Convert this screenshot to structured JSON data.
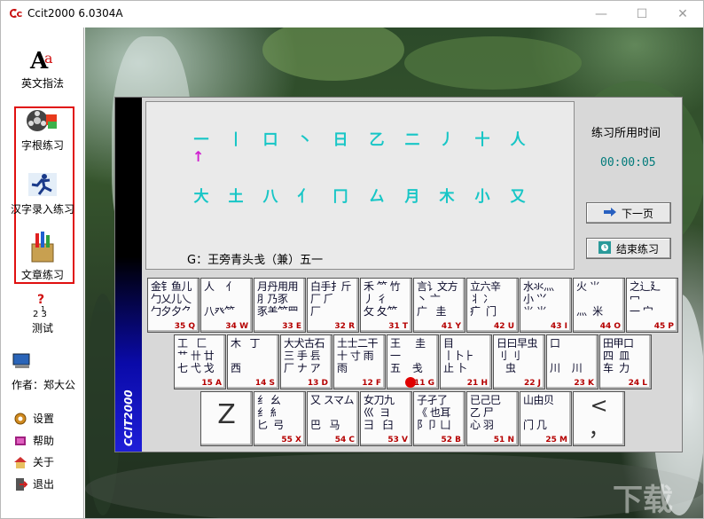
{
  "window": {
    "title": "Ccit2000 6.0304A",
    "minimize": "—",
    "maximize": "☐",
    "close": "✕"
  },
  "sidebar": {
    "english_guide": "英文指法",
    "radical_practice": "字根练习",
    "hanzi_input": "汉字录入练习",
    "article_practice": "文章练习",
    "test": "测试",
    "author": "作者：郑大公",
    "settings": "设置",
    "help": "帮助",
    "about": "关于",
    "exit": "退出"
  },
  "exercise": {
    "row1": [
      "一",
      "丨",
      "口",
      "丶",
      "日",
      "乙",
      "二",
      "丿",
      "十",
      "人"
    ],
    "row2": [
      "大",
      "土",
      "八",
      "亻",
      "冂",
      "厶",
      "月",
      "木",
      "小",
      "又"
    ],
    "hint": "G：王旁青头戋（兼）五一"
  },
  "timer": {
    "label": "练习所用时间",
    "value": "00:00:05"
  },
  "buttons": {
    "next": "下一页",
    "finish": "结束练习"
  },
  "brand": "CCIT2000",
  "keyboard": {
    "row1": [
      {
        "rads": "金钅鱼儿\n勹乂儿乀\n勹夕夕⺈",
        "code": "35 Q"
      },
      {
        "rads": "人    亻\n\n八癶⺮",
        "code": "34 W"
      },
      {
        "rads": "月丹用用\n⺼乃豕\n豕⺷⺮⺲",
        "code": "33 E"
      },
      {
        "rads": "白手扌斤\n厂 ⺁\n厂",
        "code": "32 R"
      },
      {
        "rads": "禾 ⺮ 竹\n丿 彳\n攵 夂⺮",
        "code": "31 T"
      },
      {
        "rads": "言讠文方\n丶 亠\n广   圭",
        "code": "41 Y"
      },
      {
        "rads": "立六辛\n丬 冫\n疒  门",
        "code": "42 U"
      },
      {
        "rads": "水氺⺣\n小 ⺍\n⺌ ⺌",
        "code": "43 I"
      },
      {
        "rads": "火 ⺌\n\n⺣  米",
        "code": "44 O"
      },
      {
        "rads": "之辶廴\n冖\n一 宀",
        "code": "45 P"
      }
    ],
    "row2": [
      {
        "rads": "工   匚\n艹 卄 廿\n七 弋 戈",
        "code": "15 A"
      },
      {
        "rads": "木   丁\n\n西",
        "code": "14 S"
      },
      {
        "rads": "大犬古石\n三 手 镸\n厂 ナ ア",
        "code": "13 D"
      },
      {
        "rads": "土士二干\n十 寸 雨\n雨",
        "code": "12 F"
      },
      {
        "rads": "王     圭\n一\n五    戋",
        "code": "11 G"
      },
      {
        "rads": "目\n丨卜⺊\n止 卜",
        "code": "21 H"
      },
      {
        "rads": "日曰早虫\n刂 刂\n   虫",
        "code": "22 J"
      },
      {
        "rads": "口\n\n川    川",
        "code": "23 K"
      },
      {
        "rads": "田甲口\n四  皿\n车  力",
        "code": "24 L"
      }
    ],
    "z_key": "Z",
    "row3": [
      {
        "rads": "纟 幺\n纟 ⺯\n匕  弓",
        "code": "55 X"
      },
      {
        "rads": "又 スマム\n\n巴   马",
        "code": "54 C"
      },
      {
        "rads": "女刀九\n巛  ヨ\n彐   臼",
        "code": "53 V"
      },
      {
        "rads": "子孑了\n《 也耳\n阝卩 凵",
        "code": "52 B"
      },
      {
        "rads": "已己巳\n乙 尸\n心 羽",
        "code": "51 N"
      },
      {
        "rads": "山由贝\n\n门 几",
        "code": "25 M"
      }
    ],
    "punct_key": "<\n，"
  },
  "watermark": "下载吧"
}
